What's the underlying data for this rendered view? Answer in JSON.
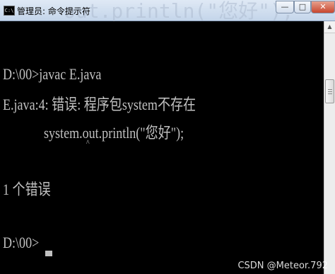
{
  "window": {
    "title": "管理员: 命令提示符",
    "icon_label": "C:\\",
    "ghost_title": "out.println(\"您好\");",
    "buttons": {
      "minimize": "—",
      "maximize": "□",
      "close": "✕"
    }
  },
  "console": {
    "lines": [
      "D:\\00>javac E.java",
      "E.java:4: 错误: 程序包system不存在",
      "system.out.println(\"您好\");",
      "^",
      "1 个错误",
      "D:\\00>"
    ]
  },
  "scrollbar": {
    "up_arrow": "▲"
  },
  "watermark": "CSDN @Meteor.792"
}
